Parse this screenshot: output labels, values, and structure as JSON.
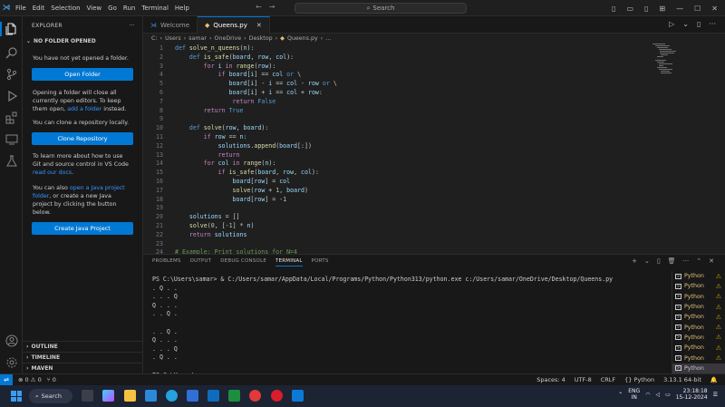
{
  "titlebar": {
    "menu": [
      "File",
      "Edit",
      "Selection",
      "View",
      "Go",
      "Run",
      "Terminal",
      "Help"
    ],
    "search_placeholder": "Search"
  },
  "sidebar": {
    "title": "EXPLORER",
    "section": "NO FOLDER OPENED",
    "msg1": "You have not yet opened a folder.",
    "open_folder": "Open Folder",
    "msg2a": "Opening a folder will close all currently open editors. To keep them open, ",
    "msg2_link": "add a folder",
    "msg2b": " instead.",
    "msg3": "You can clone a repository locally.",
    "clone_repo": "Clone Repository",
    "msg4a": "To learn more about how to use Git and source control in VS Code ",
    "msg4_link": "read our docs",
    "msg4b": ".",
    "msg5a": "You can also ",
    "msg5_link": "open a Java project folder",
    "msg5b": ", or create a new Java project by clicking the button below.",
    "create_java": "Create Java Project",
    "bottom": [
      "OUTLINE",
      "TIMELINE",
      "MAVEN"
    ]
  },
  "tabs": [
    {
      "label": "Welcome",
      "active": false
    },
    {
      "label": "Queens.py",
      "active": true
    }
  ],
  "breadcrumb": [
    "C:",
    "Users",
    "samar",
    "OneDrive",
    "Desktop",
    "Queens.py",
    "..."
  ],
  "code": {
    "lines": [
      {
        "n": "1",
        "html": "<span class='kw'>def</span> <span class='fn'>solve_n_queens</span>(<span class='pm'>n</span>):"
      },
      {
        "n": "2",
        "html": "    <span class='kw'>def</span> <span class='fn'>is_safe</span>(<span class='pm'>board</span>, <span class='pm'>row</span>, <span class='pm'>col</span>):"
      },
      {
        "n": "3",
        "html": "        <span class='kc'>for</span> <span class='pm'>i</span> <span class='kc'>in</span> <span class='fn'>range</span>(<span class='pm'>row</span>):"
      },
      {
        "n": "4",
        "html": "            <span class='kc'>if</span> <span class='pm'>board</span>[<span class='pm'>i</span>] == <span class='pm'>col</span> <span class='kw'>or</span> \\"
      },
      {
        "n": "5",
        "html": "               <span class='pm'>board</span>[<span class='pm'>i</span>] - <span class='pm'>i</span> == <span class='pm'>col</span> - <span class='pm'>row</span> <span class='kw'>or</span> \\"
      },
      {
        "n": "6",
        "html": "               <span class='pm'>board</span>[<span class='pm'>i</span>] + <span class='pm'>i</span> == <span class='pm'>col</span> + <span class='pm'>row</span>:"
      },
      {
        "n": "7",
        "html": "                <span class='kc'>return</span> <span class='bl'>False</span>"
      },
      {
        "n": "8",
        "html": "        <span class='kc'>return</span> <span class='bl'>True</span>"
      },
      {
        "n": "9",
        "html": ""
      },
      {
        "n": "10",
        "html": "    <span class='kw'>def</span> <span class='fn'>solve</span>(<span class='pm'>row</span>, <span class='pm'>board</span>):"
      },
      {
        "n": "11",
        "html": "        <span class='kc'>if</span> <span class='pm'>row</span> == <span class='pm'>n</span>:"
      },
      {
        "n": "12",
        "html": "            <span class='pm'>solutions</span>.<span class='fn'>append</span>(<span class='pm'>board</span>[:])"
      },
      {
        "n": "13",
        "html": "            <span class='kc'>return</span>"
      },
      {
        "n": "14",
        "html": "        <span class='kc'>for</span> <span class='pm'>col</span> <span class='kc'>in</span> <span class='fn'>range</span>(<span class='pm'>n</span>):"
      },
      {
        "n": "15",
        "html": "            <span class='kc'>if</span> <span class='fn'>is_safe</span>(<span class='pm'>board</span>, <span class='pm'>row</span>, <span class='pm'>col</span>):"
      },
      {
        "n": "16",
        "html": "                <span class='pm'>board</span>[<span class='pm'>row</span>] = <span class='pm'>col</span>"
      },
      {
        "n": "17",
        "html": "                <span class='fn'>solve</span>(<span class='pm'>row</span> + <span class='nm'>1</span>, <span class='pm'>board</span>)"
      },
      {
        "n": "18",
        "html": "                <span class='pm'>board</span>[<span class='pm'>row</span>] = -<span class='nm'>1</span>"
      },
      {
        "n": "19",
        "html": ""
      },
      {
        "n": "20",
        "html": "    <span class='pm'>solutions</span> = []"
      },
      {
        "n": "21",
        "html": "    <span class='fn'>solve</span>(<span class='nm'>0</span>, [-<span class='nm'>1</span>] * <span class='pm'>n</span>)"
      },
      {
        "n": "22",
        "html": "    <span class='kc'>return</span> <span class='pm'>solutions</span>"
      },
      {
        "n": "23",
        "html": ""
      },
      {
        "n": "24",
        "html": "<span class='cm'># Example: Print solutions for N=4</span>"
      }
    ]
  },
  "panel": {
    "tabs": [
      "PROBLEMS",
      "OUTPUT",
      "DEBUG CONSOLE",
      "TERMINAL",
      "PORTS"
    ],
    "active_tab": "TERMINAL",
    "terminal_text": "PS C:\\Users\\samar> & C:/Users/samar/AppData/Local/Programs/Python/Python313/python.exe c:/Users/samar/OneDrive/Desktop/Queens.py\n. Q . .\n. . . Q\nQ . . .\n. . Q .\n\n. . Q .\nQ . . .\n. . . Q\n. Q . .\n\nPS C:\\Users\\samar> ",
    "terminals": [
      "Python",
      "Python",
      "Python",
      "Python",
      "Python",
      "Python",
      "Python",
      "Python",
      "Python",
      "Python"
    ]
  },
  "status": {
    "errors": "0",
    "warnings": "0",
    "ports": "0",
    "spaces": "Spaces: 4",
    "encoding": "UTF-8",
    "eol": "CRLF",
    "language": "Python",
    "interpreter": "3.13.1 64-bit"
  },
  "taskbar": {
    "search": "Search",
    "lang1": "ENG",
    "lang2": "IN",
    "time": "23:18:18",
    "date": "15-12-2024"
  }
}
